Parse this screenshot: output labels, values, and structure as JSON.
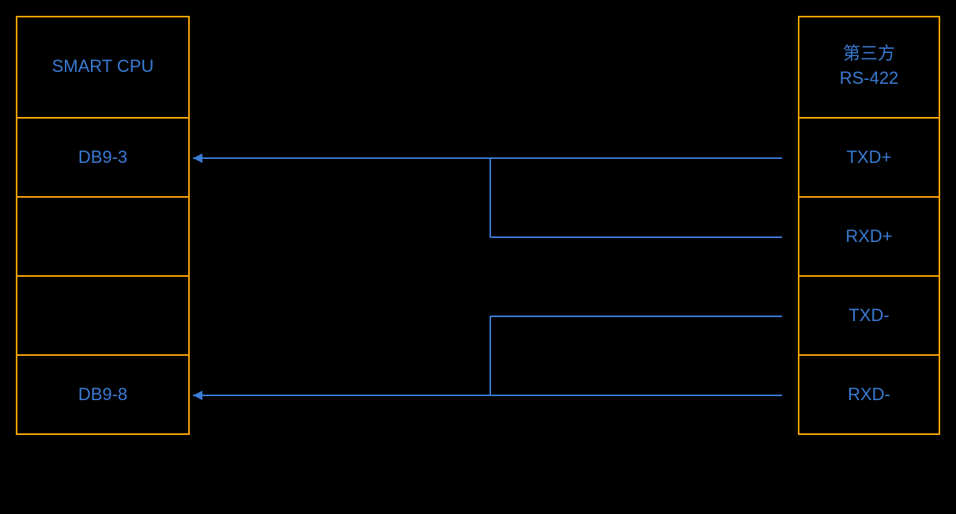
{
  "left": {
    "title": "SMART CPU",
    "rows": [
      {
        "label": "DB9-3",
        "id": "db9-3"
      },
      {
        "label": "",
        "id": "empty-1"
      },
      {
        "label": "",
        "id": "empty-2"
      },
      {
        "label": "DB9-8",
        "id": "db9-8"
      },
      {
        "label": "",
        "id": "empty-3"
      }
    ]
  },
  "right": {
    "title_line1": "第三方",
    "title_line2": "RS-422",
    "rows": [
      {
        "label": "TXD+",
        "id": "txd-plus"
      },
      {
        "label": "RXD+",
        "id": "rxd-plus"
      },
      {
        "label": "TXD-",
        "id": "txd-minus"
      },
      {
        "label": "RXD-",
        "id": "rxd-minus"
      },
      {
        "label": "",
        "id": "empty-r"
      }
    ]
  },
  "colors": {
    "border": "#FFA500",
    "text": "#3a7bd5",
    "line": "#3a7bd5",
    "bg": "#000000"
  }
}
